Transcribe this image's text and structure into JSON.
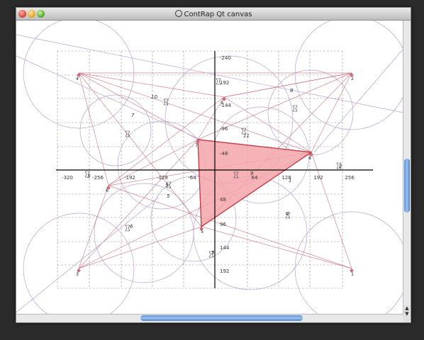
{
  "window": {
    "title": "ContRap Qt canvas"
  },
  "icons": {
    "close": "close-traffic-icon",
    "minimize": "minimize-traffic-icon",
    "maximize": "maximize-traffic-icon",
    "title": "no-entry-icon"
  },
  "colors": {
    "curve": "#c86a7a",
    "triangle_fill": "#f4a6aa",
    "circles": "#b9a4cf",
    "grid": "#9a9a9a"
  },
  "axes": {
    "x_ticks": [
      "-320",
      "-256",
      "-192",
      "-128",
      "-64",
      "64",
      "128",
      "192",
      "256"
    ],
    "y_ticks": [
      "-240",
      "192",
      "-144",
      "-96",
      "-48",
      "48",
      "96",
      "144",
      "192"
    ]
  },
  "points": [
    {
      "label": "1"
    },
    {
      "label": "2"
    },
    {
      "label": "3"
    },
    {
      "label": "4"
    },
    {
      "label": "5"
    },
    {
      "label": "6"
    },
    {
      "label": "7"
    },
    {
      "label": "8"
    },
    {
      "label": "9"
    },
    {
      "label": "10"
    },
    {
      "label": "11"
    }
  ],
  "annotations": [
    "10",
    "7",
    "8",
    "11",
    "5",
    "9",
    "4",
    "6",
    "5",
    "3",
    "2",
    "1",
    "5"
  ],
  "scroll": {
    "horizontal": 0.5,
    "vertical": 0.55
  }
}
